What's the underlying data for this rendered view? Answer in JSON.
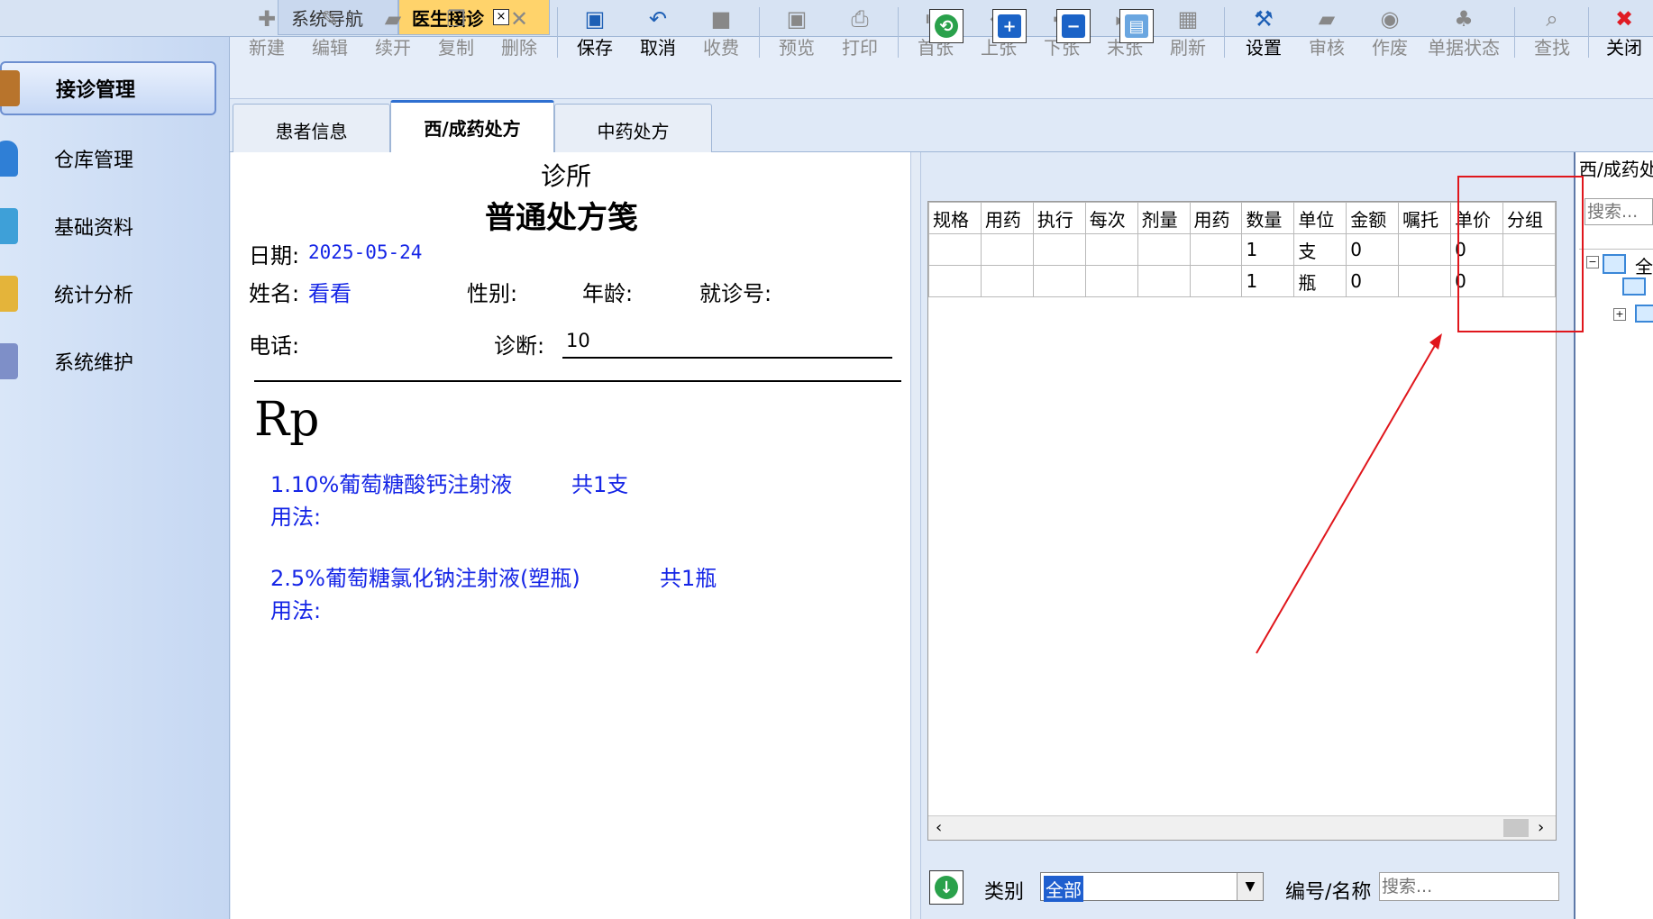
{
  "top_tabs": [
    {
      "label": "系统导航"
    },
    {
      "label": "医生接诊",
      "close": "×"
    }
  ],
  "sidebar": {
    "items": [
      {
        "label": "接诊管理",
        "icon": "cabinet-icon",
        "color": "#b8742c"
      },
      {
        "label": "仓库管理",
        "icon": "person-icon",
        "color": "#2f7fd6"
      },
      {
        "label": "基础资料",
        "icon": "box-icon",
        "color": "#3ea0d8"
      },
      {
        "label": "统计分析",
        "icon": "folder-chart-icon",
        "color": "#e4b43a"
      },
      {
        "label": "系统维护",
        "icon": "books-icon",
        "color": "#7e8fc8"
      }
    ]
  },
  "toolbar": {
    "buttons": [
      {
        "label": "新建",
        "icon": "plus-icon",
        "glyph": "✚"
      },
      {
        "label": "编辑",
        "icon": "pen-icon",
        "glyph": "✎"
      },
      {
        "label": "续开",
        "icon": "folder-icon",
        "glyph": "▰"
      },
      {
        "label": "复制",
        "icon": "copy-icon",
        "glyph": "❐"
      },
      {
        "label": "删除",
        "icon": "x-icon",
        "glyph": "✕"
      },
      {
        "label": "保存",
        "icon": "floppy-icon",
        "glyph": "▣"
      },
      {
        "label": "取消",
        "icon": "undo-icon",
        "glyph": "↶"
      },
      {
        "label": "收费",
        "icon": "cash-icon",
        "glyph": "■"
      },
      {
        "label": "预览",
        "icon": "preview-icon",
        "glyph": "▣"
      },
      {
        "label": "打印",
        "icon": "printer-icon",
        "glyph": "⎙"
      },
      {
        "label": "首张",
        "icon": "first-icon",
        "glyph": "⏮"
      },
      {
        "label": "上张",
        "icon": "prev-icon",
        "glyph": "⬅"
      },
      {
        "label": "下张",
        "icon": "next-icon",
        "glyph": "➡"
      },
      {
        "label": "末张",
        "icon": "last-icon",
        "glyph": "⏭"
      },
      {
        "label": "刷新",
        "icon": "refresh-grid-icon",
        "glyph": "▦"
      },
      {
        "label": "设置",
        "icon": "tools-icon",
        "glyph": "⚒"
      },
      {
        "label": "审核",
        "icon": "audit-icon",
        "glyph": "▰"
      },
      {
        "label": "作废",
        "icon": "void-icon",
        "glyph": "◉"
      },
      {
        "label": "单据状态",
        "icon": "bell-icon",
        "glyph": "♣"
      },
      {
        "label": "查找",
        "icon": "find-icon",
        "glyph": "⌕"
      },
      {
        "label": "关闭",
        "icon": "close-circle-icon",
        "glyph": "✖"
      }
    ]
  },
  "content_tabs": [
    {
      "label": "患者信息"
    },
    {
      "label": "西/成药处方"
    },
    {
      "label": "中药处方"
    }
  ],
  "prescription": {
    "clinic": "诊所",
    "title": "普通处方笺",
    "date_label": "日期:",
    "date": "2025-05-24",
    "name_label": "姓名:",
    "name": "看看",
    "gender_label": "性别:",
    "age_label": "年龄:",
    "visit_label": "就诊号:",
    "phone_label": "电话:",
    "diagnosis_label": "诊断:",
    "diagnosis": "10",
    "rp": "Rp",
    "items": [
      {
        "text": "1.10%葡萄糖酸钙注射液",
        "qty": "共1支",
        "usage": "用法:"
      },
      {
        "text": "2.5%葡萄糖氯化钠注射液(塑瓶)",
        "qty": "共1瓶",
        "usage": "用法:"
      }
    ]
  },
  "grid": {
    "columns": [
      "规格",
      "用药",
      "执行",
      "每次",
      "剂量",
      "用药",
      "数量",
      "单位",
      "金额",
      "嘱托",
      "单价",
      "分组"
    ],
    "rows": [
      [
        "",
        "",
        "",
        "",
        "",
        "",
        "1",
        "支",
        "0",
        "",
        "0",
        ""
      ],
      [
        "",
        "",
        "",
        "",
        "",
        "",
        "1",
        "瓶",
        "0",
        "",
        "0",
        ""
      ]
    ]
  },
  "filter": {
    "category_label": "类别",
    "category_value": "全部",
    "code_label": "编号/名称",
    "search_placeholder": "搜索..."
  },
  "tree_panel": {
    "title": "西/成药处",
    "search_placeholder": "搜索...",
    "root_label": "全"
  },
  "colors": {
    "highlight_box": "#e0161c",
    "arrow": "#e0161c",
    "blue_text": "#1525e6"
  }
}
